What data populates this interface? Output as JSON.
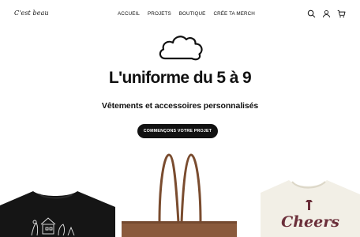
{
  "header": {
    "logo": "C'est beau",
    "nav": [
      "ACCUEIL",
      "PROJETS",
      "BOUTIQUE",
      "CRÉE TA MERCH"
    ]
  },
  "hero": {
    "title": "L'uniforme du 5 à 9",
    "subtitle": "Vêtements et accessoires personnalisés",
    "cta": "COMMENÇONS VOTRE PROJET"
  },
  "products": {
    "cream_tshirt_print": "Cheers"
  },
  "icons": [
    "search-icon",
    "account-icon",
    "cart-icon",
    "cloud-icon"
  ],
  "colors": {
    "primary": "#111111",
    "background": "#ffffff",
    "tote": "#8a5a3c",
    "cream_tshirt": "#f2efe6",
    "print": "#6b2f3a"
  }
}
